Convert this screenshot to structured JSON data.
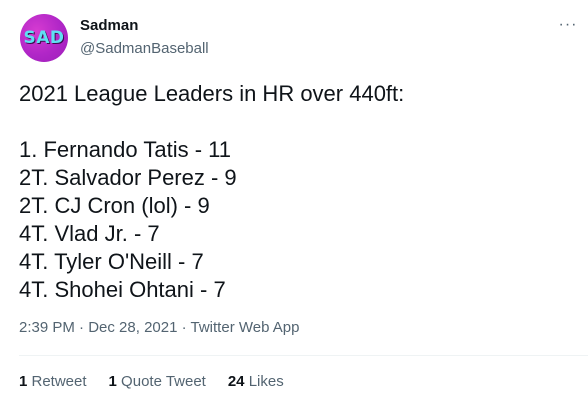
{
  "author": {
    "avatar_text": "SAD",
    "name": "Sadman",
    "handle": "@SadmanBaseball"
  },
  "more_icon": "more-horizontal-icon",
  "tweet": {
    "title_line": "2021 League Leaders in HR over 440ft:",
    "lines": [
      "1. Fernando Tatis - 11",
      "2T. Salvador Perez - 9",
      "2T. CJ Cron (lol) - 9",
      "4T. Vlad Jr. - 7",
      "4T. Tyler O'Neill - 7",
      "4T. Shohei Ohtani - 7"
    ]
  },
  "meta": {
    "time": "2:39 PM",
    "separator1": " · ",
    "date": "Dec 28, 2021",
    "separator2": " · ",
    "source": "Twitter Web App"
  },
  "stats": {
    "retweets_count": "1",
    "retweets_label": " Retweet",
    "quotes_count": "1",
    "quotes_label": " Quote Tweet",
    "likes_count": "24",
    "likes_label": " Likes"
  },
  "colors": {
    "text_primary": "#0f1419",
    "text_secondary": "#536471",
    "divider": "#eff3f4",
    "avatar_bg": "#b026c7",
    "avatar_text": "#5fe0f2"
  }
}
